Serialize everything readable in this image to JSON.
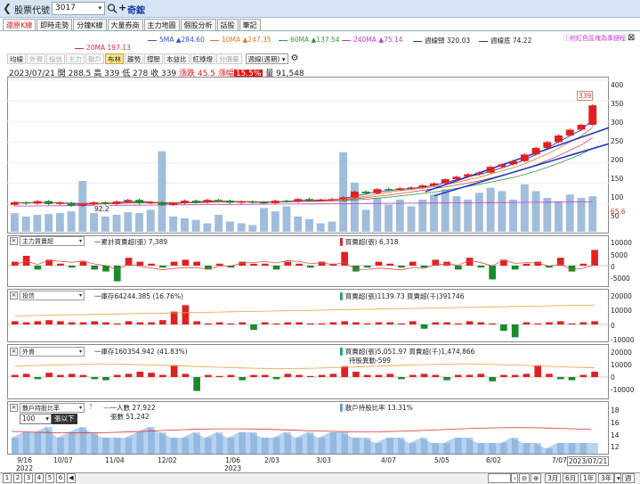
{
  "header": {
    "back_icon": "back-arrow-icon",
    "code_label": "股票代號",
    "code_value": "3017",
    "stock_name": "奇鋐"
  },
  "tabs": [
    "還原K線",
    "即時走勢",
    "分鐘K線",
    "大量券商",
    "主力地圖",
    "個股分析",
    "話股",
    "筆記"
  ],
  "ma_legend": [
    {
      "label": "5MA ▲284.60",
      "color": "#3a4fd8"
    },
    {
      "label": "10MA ▲247.35",
      "color": "#d07a20"
    },
    {
      "label": "60MA ▲137.54",
      "color": "#2f9a3a"
    },
    {
      "label": "240MA ▲75.14",
      "color": "#c03ad0"
    },
    {
      "label": "週線頸 320.03",
      "color": "#333333"
    },
    {
      "label": "週線底 74.22",
      "color": "#333333"
    },
    {
      "label": "20MA 197.13",
      "color": "#e03030"
    }
  ],
  "right_link": "ⓘ何紅色區塊為事鏈程",
  "close_icon": "close-x-icon",
  "toolbar": {
    "items": [
      "均線",
      "外資",
      "投信",
      "主力",
      "散戶",
      "布林",
      "趨勢",
      "撐壓",
      "本益比",
      "紅綠燈",
      "分價量"
    ],
    "active": "布林",
    "dim": [
      "外資",
      "投信",
      "主力",
      "散戶",
      "分價量"
    ],
    "range": "週線(週期)",
    "gear": "gear-icon"
  },
  "quote": {
    "date": "2023/07/21",
    "open": "開 288.5",
    "high": "高 339",
    "low": "低 278",
    "close": "收 339",
    "change": "漲跌 45.5",
    "pct_label": "漲幅",
    "pct": "15.5%",
    "vol": "量 91,548"
  },
  "price_axis": [
    "400",
    "350",
    "300",
    "250",
    "200",
    "150",
    "100",
    "50"
  ],
  "last_price": "65.6",
  "peak_label": "339",
  "low_label": "92.2",
  "panels": {
    "main_force": {
      "select": "主力買賣超",
      "title": "一累計買賣超(張) 7,389",
      "title2": "買賣超(張) 6,318",
      "axis": [
        "10000",
        "5000",
        "0",
        "-5000"
      ]
    },
    "trust": {
      "select": "投信",
      "title": "一庫存64244.385 (16.76%)",
      "title2": "買賣超(張)1139.73 買賣超(千)391746",
      "axis": [
        "20000",
        "10000",
        "0",
        "-10000"
      ]
    },
    "foreign": {
      "select": "外資",
      "title": "一庫存160354.942 (41.83%)",
      "title2": "買賣超(張)5,051.97 買賣超(千)1,474,866",
      "title3": "持股異動-599",
      "axis": [
        "20000",
        "10000",
        "0",
        "-10000"
      ]
    },
    "retail": {
      "select": "散戶持股比率",
      "help": "?",
      "title": "一人數 27,922",
      "title_b": "張數 51,242",
      "title2": "散戶持股比率 13.31%",
      "axis": [
        "18",
        "16",
        "14",
        "12"
      ],
      "dd_value": "100",
      "dd_tip": "張以下"
    }
  },
  "x_axis": [
    {
      "label": "9/16",
      "sub": "2022"
    },
    {
      "label": "10/07",
      "sub": ""
    },
    {
      "label": "11/04",
      "sub": ""
    },
    {
      "label": "12/02",
      "sub": ""
    },
    {
      "label": "1/06",
      "sub": "2023"
    },
    {
      "label": "2/03",
      "sub": ""
    },
    {
      "label": "3/03",
      "sub": ""
    },
    {
      "label": "4/07",
      "sub": ""
    },
    {
      "label": "5/05",
      "sub": ""
    },
    {
      "label": "6/02",
      "sub": ""
    },
    {
      "label": "7/07",
      "sub": ""
    },
    {
      "label": "2023/07/21",
      "sub": ""
    }
  ],
  "bottom": {
    "pages": [
      "1",
      "2",
      "3",
      "4",
      "5",
      "6"
    ],
    "nav": "◀",
    "zoom_out": "zoom-out-icon",
    "zoom_in": "zoom-in-icon",
    "periods": [
      "3月",
      "6月",
      "1年",
      "3年"
    ],
    "more": "▾",
    "icon_label": "週",
    "right": "週"
  },
  "chart_data": {
    "type": "candlestick",
    "candles": [
      {
        "o": 98,
        "c": 104
      },
      {
        "o": 104,
        "c": 101
      },
      {
        "o": 101,
        "c": 107
      },
      {
        "o": 107,
        "c": 100
      },
      {
        "o": 100,
        "c": 103
      },
      {
        "o": 103,
        "c": 96
      },
      {
        "o": 96,
        "c": 99
      },
      {
        "o": 99,
        "c": 104
      },
      {
        "o": 104,
        "c": 100
      },
      {
        "o": 100,
        "c": 106
      },
      {
        "o": 106,
        "c": 110
      },
      {
        "o": 110,
        "c": 102
      },
      {
        "o": 102,
        "c": 104
      },
      {
        "o": 104,
        "c": 98
      },
      {
        "o": 98,
        "c": 102
      },
      {
        "o": 102,
        "c": 108
      },
      {
        "o": 108,
        "c": 104
      },
      {
        "o": 104,
        "c": 110
      },
      {
        "o": 110,
        "c": 108
      },
      {
        "o": 108,
        "c": 103
      },
      {
        "o": 103,
        "c": 106
      },
      {
        "o": 106,
        "c": 104
      },
      {
        "o": 104,
        "c": 102
      },
      {
        "o": 102,
        "c": 108
      },
      {
        "o": 108,
        "c": 106
      },
      {
        "o": 106,
        "c": 112
      },
      {
        "o": 112,
        "c": 108
      },
      {
        "o": 108,
        "c": 110
      },
      {
        "o": 110,
        "c": 112
      },
      {
        "o": 112,
        "c": 116
      },
      {
        "o": 116,
        "c": 130
      },
      {
        "o": 130,
        "c": 126
      },
      {
        "o": 126,
        "c": 136
      },
      {
        "o": 136,
        "c": 134
      },
      {
        "o": 134,
        "c": 138
      },
      {
        "o": 138,
        "c": 140
      },
      {
        "o": 140,
        "c": 145
      },
      {
        "o": 145,
        "c": 150
      },
      {
        "o": 150,
        "c": 160
      },
      {
        "o": 160,
        "c": 166
      },
      {
        "o": 166,
        "c": 172
      },
      {
        "o": 172,
        "c": 176
      },
      {
        "o": 176,
        "c": 190
      },
      {
        "o": 190,
        "c": 196
      },
      {
        "o": 196,
        "c": 204
      },
      {
        "o": 204,
        "c": 220
      },
      {
        "o": 220,
        "c": 236
      },
      {
        "o": 236,
        "c": 250
      },
      {
        "o": 250,
        "c": 266
      },
      {
        "o": 266,
        "c": 280
      },
      {
        "o": 280,
        "c": 292
      },
      {
        "o": 292,
        "c": 339
      }
    ],
    "ylim": [
      50,
      400
    ]
  }
}
